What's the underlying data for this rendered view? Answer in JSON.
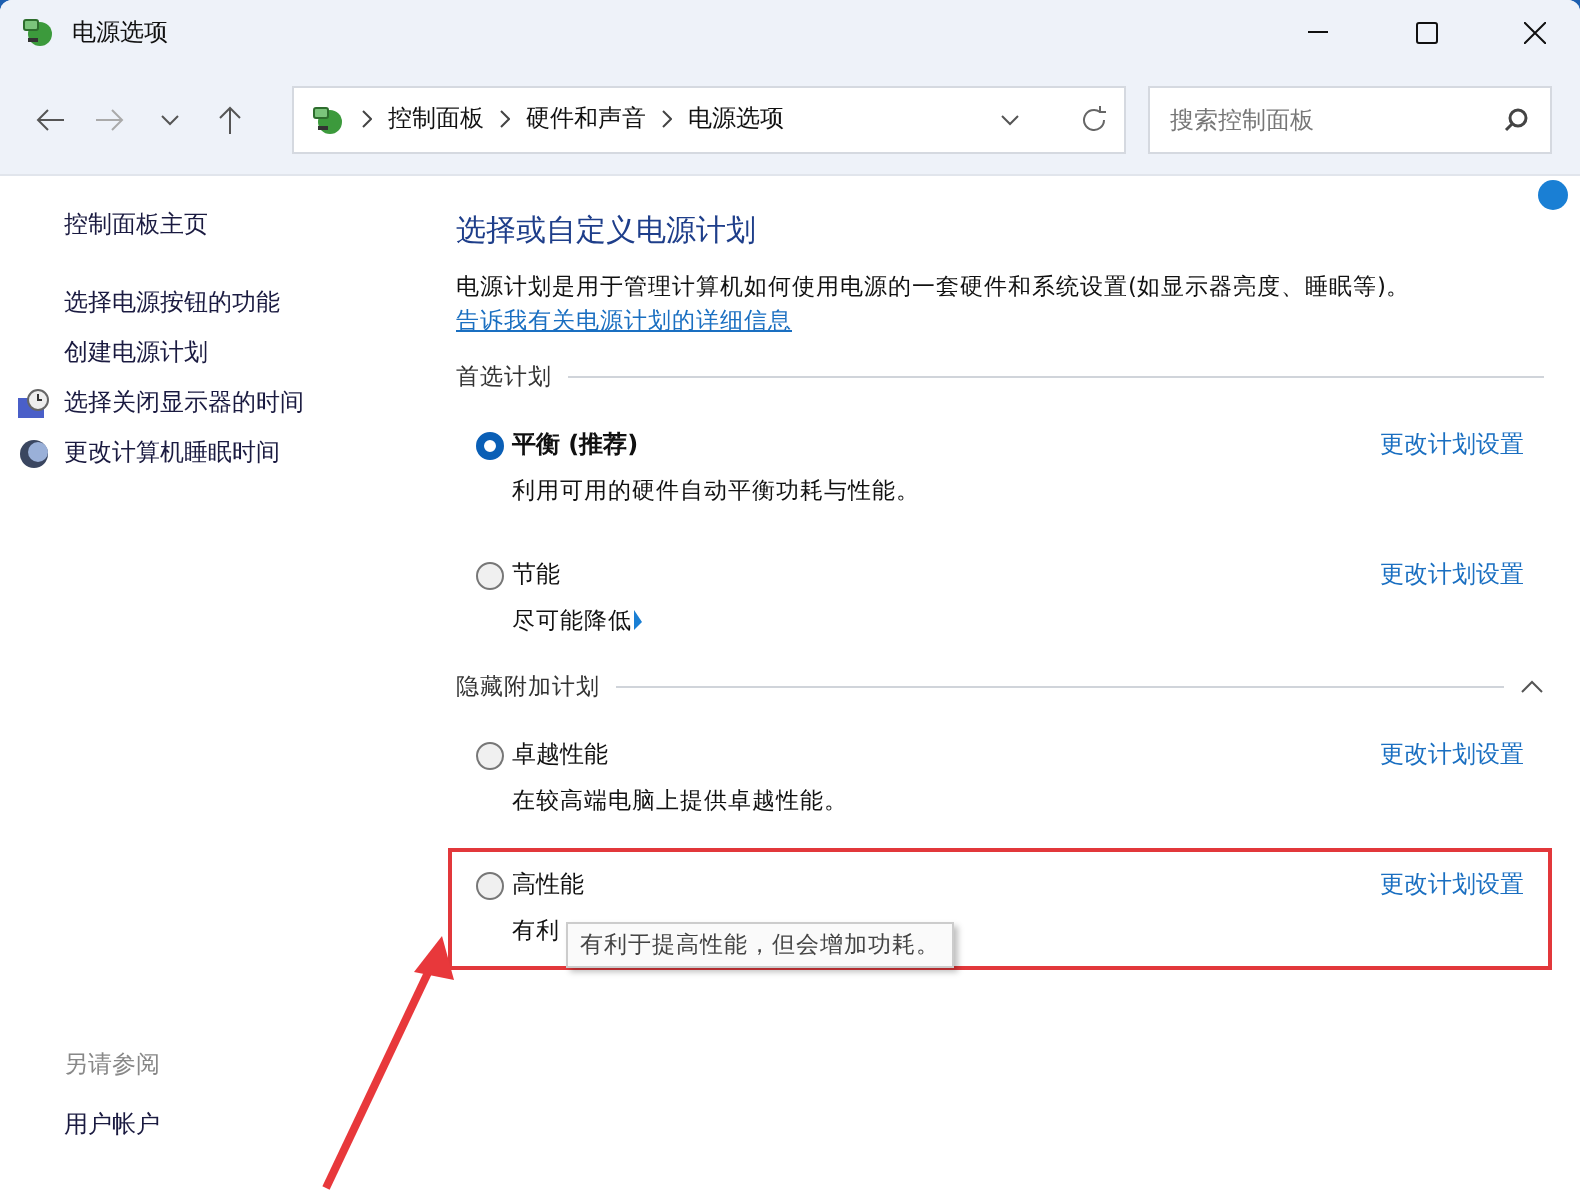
{
  "window": {
    "title": "电源选项"
  },
  "address": {
    "crumbs": [
      "控制面板",
      "硬件和声音",
      "电源选项"
    ]
  },
  "search": {
    "placeholder": "搜索控制面板"
  },
  "sidebar": {
    "items": [
      {
        "label": "控制面板主页",
        "kind": "home"
      },
      {
        "label": "选择电源按钮的功能",
        "kind": "plain"
      },
      {
        "label": "创建电源计划",
        "kind": "plain"
      },
      {
        "label": "选择关闭显示器的时间",
        "kind": "clock"
      },
      {
        "label": "更改计算机睡眠时间",
        "kind": "moon"
      }
    ],
    "see_also": {
      "heading": "另请参阅",
      "items": [
        "用户帐户"
      ]
    }
  },
  "main": {
    "title": "选择或自定义电源计划",
    "intro": "电源计划是用于管理计算机如何使用电源的一套硬件和系统设置(如显示器亮度、睡眠等)。",
    "intro_link": "告诉我有关电源计划的详细信息",
    "groups": [
      {
        "heading": "首选计划",
        "plans": [
          {
            "name": "平衡 (推荐)",
            "selected": true,
            "description": "利用可用的硬件自动平衡功耗与性能。",
            "link": "更改计划设置",
            "highlighted": false,
            "cursor": false
          },
          {
            "name": "节能",
            "selected": false,
            "description": "尽可能降低",
            "link": "更改计划设置",
            "highlighted": false,
            "cursor": true
          }
        ]
      },
      {
        "heading": "隐藏附加计划",
        "expanded": true,
        "plans": [
          {
            "name": "卓越性能",
            "selected": false,
            "description": "在较高端电脑上提供卓越性能。",
            "link": "更改计划设置",
            "highlighted": false,
            "cursor": false
          },
          {
            "name": "高性能",
            "selected": false,
            "description": "有利",
            "link": "更改计划设置",
            "highlighted": true,
            "cursor": false,
            "tooltip": "有利于提高性能，但会增加功耗。"
          }
        ]
      }
    ]
  },
  "arrow_annotation": true
}
